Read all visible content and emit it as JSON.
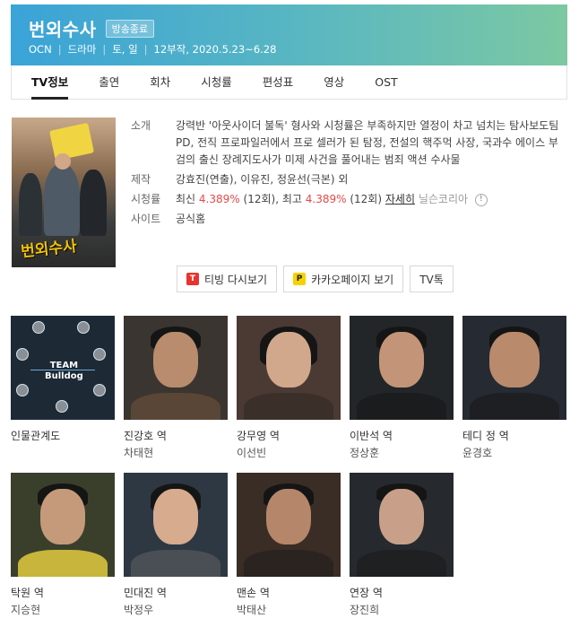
{
  "header": {
    "title": "번외수사",
    "badge": "방송종료",
    "channel": "OCN",
    "genre": "드라마",
    "days": "토, 일",
    "episodes_dates": "12부작, 2020.5.23~6.28"
  },
  "tabs": [
    {
      "label": "TV정보",
      "active": true
    },
    {
      "label": "출연"
    },
    {
      "label": "회차"
    },
    {
      "label": "시청률"
    },
    {
      "label": "편성표"
    },
    {
      "label": "영상"
    },
    {
      "label": "OST"
    }
  ],
  "poster": {
    "title_text": "번외수사"
  },
  "info": {
    "synopsis_label": "소개",
    "synopsis": "강력반 '아웃사이더 불독' 형사와 시청률은 부족하지만 열정이 차고 넘치는 탐사보도팀 PD, 전직 프로파일러에서 프로 셀러가 된 탐정, 전설의 핵주먹 사장, 국과수 에이스 부검의 출신 장례지도사가 미제 사건을 풀어내는 범죄 액션 수사물",
    "production_label": "제작",
    "production": "강효진(연출), 이유진, 정윤선(극본) 외",
    "ratings_label": "시청률",
    "ratings_latest_prefix": "최신",
    "ratings_latest_value": "4.389%",
    "ratings_latest_ep": "(12회),",
    "ratings_max_prefix": "최고",
    "ratings_max_value": "4.389%",
    "ratings_max_ep": "(12회)",
    "ratings_detail_link": "자세히",
    "ratings_source": "닐슨코리아",
    "site_label": "사이트",
    "site_link": "공식홈"
  },
  "buttons": {
    "tving": "티빙 다시보기",
    "kakao": "카카오페이지 보기",
    "tvtalk": "TV톡"
  },
  "relation_map": {
    "label": "인물관계도",
    "team_line1": "TEAM",
    "team_line2": "Bulldog"
  },
  "cast": [
    {
      "role": "진강호 역",
      "actor": "차태현"
    },
    {
      "role": "강무영 역",
      "actor": "이선빈"
    },
    {
      "role": "이반석 역",
      "actor": "정상훈"
    },
    {
      "role": "테디 정 역",
      "actor": "윤경호"
    },
    {
      "role": "탁원 역",
      "actor": "지승현"
    },
    {
      "role": "민대진 역",
      "actor": "박정우"
    },
    {
      "role": "맨손 역",
      "actor": "박태산"
    },
    {
      "role": "연장 역",
      "actor": "장진희"
    }
  ],
  "colors": {
    "accent_red": "#e64a4a",
    "header_start": "#3aa3d8",
    "header_end": "#7cc8a2"
  },
  "icons": [
    "tving-icon",
    "kakaopage-icon",
    "exclamation-icon"
  ]
}
